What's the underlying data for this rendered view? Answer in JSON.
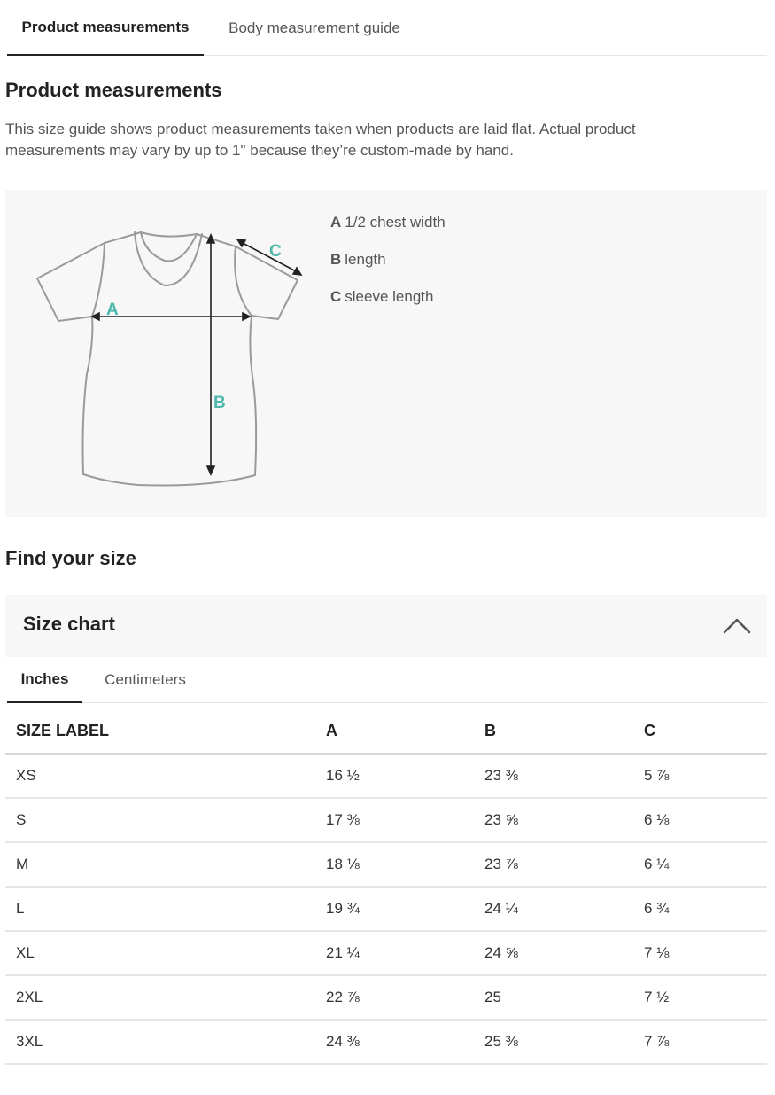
{
  "top_tabs": [
    {
      "label": "Product measurements",
      "active": true
    },
    {
      "label": "Body measurement guide",
      "active": false
    }
  ],
  "section": {
    "title": "Product measurements",
    "description": "This size guide shows product measurements taken when products are laid flat. Actual product measurements may vary by up to 1\" because they’re custom-made by hand."
  },
  "diagram": {
    "markers": {
      "a": "A",
      "b": "B",
      "c": "C"
    },
    "legend": [
      {
        "key": "A",
        "text": "1/2 chest width"
      },
      {
        "key": "B",
        "text": "length"
      },
      {
        "key": "C",
        "text": "sleeve length"
      }
    ],
    "accent_color": "#4fb8ad"
  },
  "find_size": {
    "title": "Find your size"
  },
  "size_chart": {
    "title": "Size chart",
    "collapse_icon": "chevron-up-icon",
    "unit_tabs": [
      {
        "label": "Inches",
        "active": true
      },
      {
        "label": "Centimeters",
        "active": false
      }
    ],
    "columns": [
      "SIZE LABEL",
      "A",
      "B",
      "C"
    ],
    "rows": [
      [
        "XS",
        "16 ½",
        "23 ⅜",
        "5 ⅞"
      ],
      [
        "S",
        "17 ⅜",
        "23 ⅝",
        "6 ⅛"
      ],
      [
        "M",
        "18 ⅛",
        "23 ⅞",
        "6 ¼"
      ],
      [
        "L",
        "19 ¾",
        "24 ¼",
        "6 ¾"
      ],
      [
        "XL",
        "21 ¼",
        "24 ⅝",
        "7 ⅛"
      ],
      [
        "2XL",
        "22 ⅞",
        "25",
        "7 ½"
      ],
      [
        "3XL",
        "24 ⅜",
        "25 ⅜",
        "7 ⅞"
      ]
    ]
  }
}
